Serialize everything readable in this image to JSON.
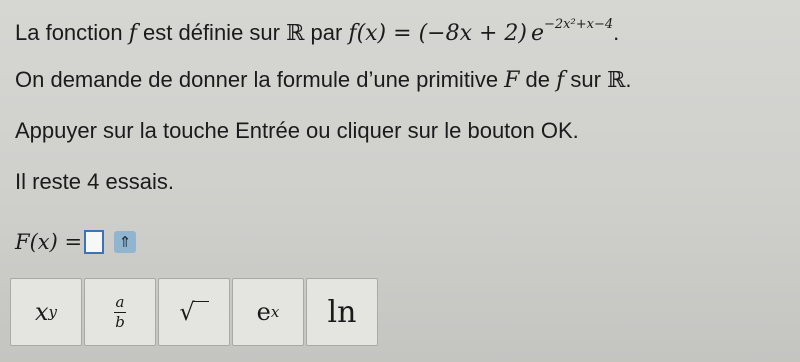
{
  "statement": {
    "intro": "La fonction ",
    "f_symbol": "f",
    "mid": " est définie sur ",
    "reals": "ℝ",
    "par": " par ",
    "fx": "f(x)",
    "equals": " = ",
    "factor": "(−8x + 2)",
    "exp_base": "e",
    "exponent": "−2x²+x−4",
    "end": "."
  },
  "request": {
    "text_before": "On demande de donner la formule d’une primitive ",
    "F_symbol": "F",
    "de": " de ",
    "f_symbol": "f",
    "sur": " sur ",
    "reals": "ℝ",
    "end": "."
  },
  "instruction": "Appuyer sur la touche Entrée ou cliquer sur le bouton OK.",
  "attempts": "Il reste 4 essais.",
  "answer": {
    "label": "F(x) =",
    "value": "",
    "expand_glyph": "⇑"
  },
  "keypad": {
    "power": {
      "base": "x",
      "exp": "y"
    },
    "fraction": {
      "num": "a",
      "den": "b"
    },
    "sqrt": "√",
    "exp": {
      "base": "e",
      "exp": "x"
    },
    "ln": "ln"
  },
  "icons": {
    "expand": "double-up-arrow-icon"
  },
  "colors": {
    "answer_border": "#3a73b8",
    "expand_button": "#8fb5cf"
  }
}
